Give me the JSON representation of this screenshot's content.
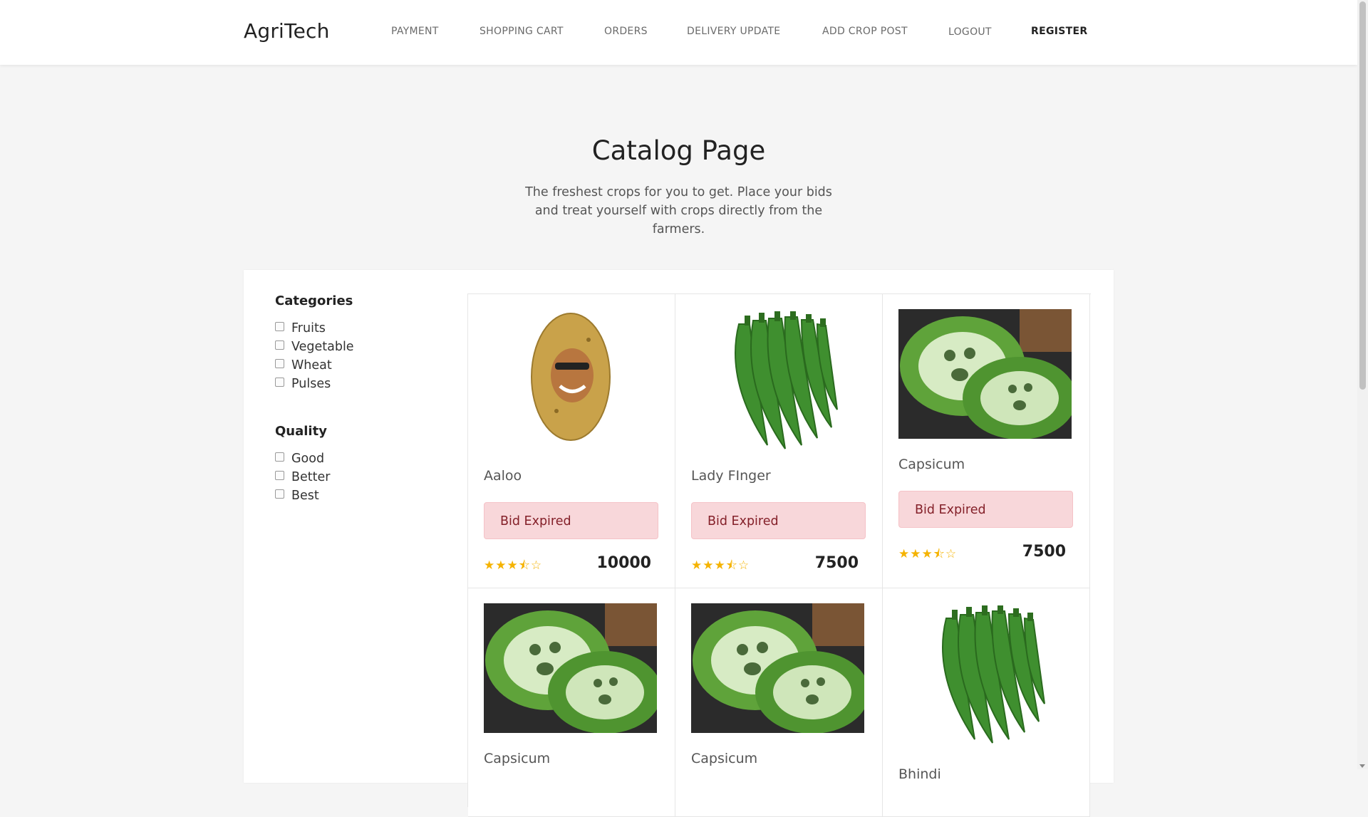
{
  "brand": "AgriTech",
  "nav": {
    "payment": "PAYMENT",
    "cart": "SHOPPING CART",
    "orders": "ORDERS",
    "delivery": "DELIVERY UPDATE",
    "add_crop": "ADD CROP POST",
    "logout": "LOGOUT",
    "register": "REGISTER"
  },
  "hero": {
    "title": "Catalog Page",
    "subtitle": "The freshest crops for you to get. Place your bids and treat yourself with crops directly from the farmers."
  },
  "filters": {
    "categories_title": "Categories",
    "categories": [
      "Fruits",
      "Vegetable",
      "Wheat",
      "Pulses"
    ],
    "quality_title": "Quality",
    "quality": [
      "Good",
      "Better",
      "Best"
    ]
  },
  "products": [
    {
      "name": "Aaloo",
      "image": "potato-face-image",
      "bid": "Bid Expired",
      "rating": 3.5,
      "price": "10000"
    },
    {
      "name": "Lady FInger",
      "image": "okra-image",
      "bid": "Bid Expired",
      "rating": 3.5,
      "price": "7500"
    },
    {
      "name": "Capsicum",
      "image": "capsicum-image",
      "bid": "Bid Expired",
      "rating": 3.5,
      "price": "7500"
    },
    {
      "name": "Capsicum",
      "image": "capsicum-image"
    },
    {
      "name": "Capsicum",
      "image": "capsicum-image"
    },
    {
      "name": "Bhindi",
      "image": "okra-image"
    }
  ],
  "colors": {
    "accent_star": "#f5b301",
    "bid_expired_bg": "#f8d7da",
    "bid_expired_text": "#842029"
  }
}
